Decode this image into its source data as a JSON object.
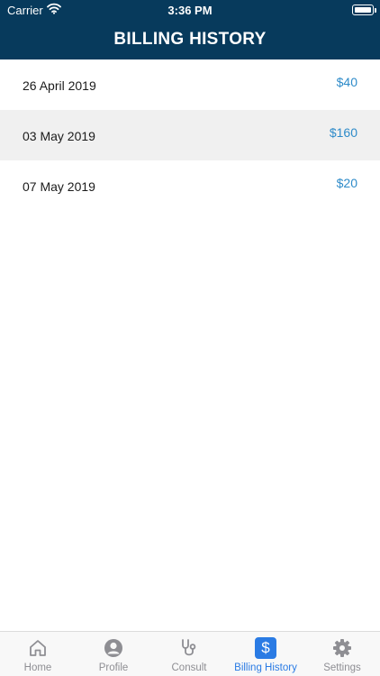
{
  "status_bar": {
    "carrier": "Carrier",
    "time": "3:36 PM"
  },
  "header": {
    "title": "BILLING HISTORY"
  },
  "billing_items": [
    {
      "date": "26 April 2019",
      "amount": "$40"
    },
    {
      "date": "03 May 2019",
      "amount": "$160"
    },
    {
      "date": "07 May 2019",
      "amount": "$20"
    }
  ],
  "tab_bar": {
    "items": [
      {
        "label": "Home",
        "icon": "home-icon"
      },
      {
        "label": "Profile",
        "icon": "profile-icon"
      },
      {
        "label": "Consult",
        "icon": "stethoscope-icon"
      },
      {
        "label": "Billing History",
        "icon": "dollar-icon",
        "active": true
      },
      {
        "label": "Settings",
        "icon": "gear-icon"
      }
    ]
  },
  "colors": {
    "header_bg": "#073a5c",
    "accent": "#2a7be4",
    "amount": "#2e8bc9"
  }
}
